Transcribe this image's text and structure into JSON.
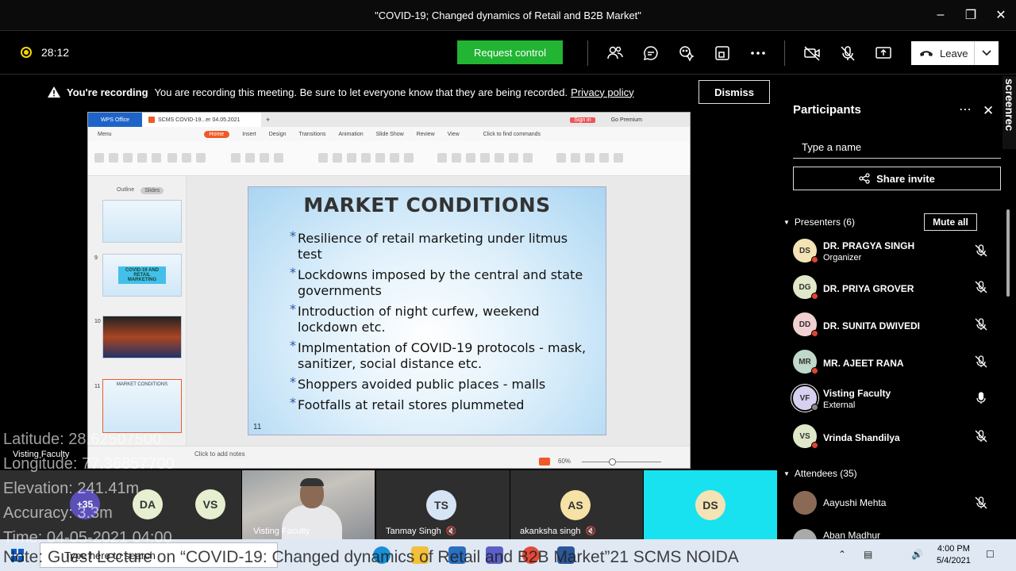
{
  "window": {
    "title": "\"COVID-19; Changed dynamics of Retail and B2B Market\""
  },
  "toolbar": {
    "timer": "28:12",
    "request_control": "Request control",
    "leave": "Leave"
  },
  "recording": {
    "bold": "You're recording",
    "message": "You are recording this meeting. Be sure to let everyone know that they are being recorded.",
    "policy": "Privacy policy",
    "dismiss": "Dismiss"
  },
  "wps": {
    "tab_app": "WPS Office",
    "tab_doc": "SCMS COVID-19...er 04.05.2021",
    "sign_in": "Sign in",
    "premium": "Go Premium",
    "menu": "Menu",
    "ribbon_tabs": [
      "Home",
      "Insert",
      "Design",
      "Transitions",
      "Animation",
      "Slide Show",
      "Review",
      "View"
    ],
    "find": "Click to find commands",
    "outline": "Outline",
    "slides": "Slides",
    "thumb_numbers": [
      "9",
      "10",
      "11"
    ],
    "thumb9_text": "COVID-19 AND RETAIL MARKETING",
    "thumb11_text": "MARKET CONDITIONS",
    "click_notes": "Click to add notes",
    "zoom": "60%"
  },
  "slide": {
    "title": "MARKET CONDITIONS",
    "bullets": [
      "Resilience of retail marketing under litmus test",
      "Lockdowns imposed by the central and state governments",
      "Introduction of night curfew, weekend lockdown etc.",
      "Implmentation of COVID-19 protocols - mask, sanitizer, social distance etc.",
      "Shoppers avoided public places - malls",
      "Footfalls at retail stores plummeted"
    ],
    "page_number": "11"
  },
  "participants": {
    "title": "Participants",
    "search_placeholder": "Type a name",
    "share_invite": "Share invite",
    "presenters_label": "Presenters (6)",
    "mute_all": "Mute all",
    "attendees_label": "Attendees (35)",
    "presenters": [
      {
        "initials": "DS",
        "name": "DR. PRAGYA SINGH",
        "role": "Organizer",
        "color": "#f3e3b5"
      },
      {
        "initials": "DG",
        "name": "DR. PRIYA GROVER",
        "role": "",
        "color": "#dfe8c8"
      },
      {
        "initials": "DD",
        "name": "DR. SUNITA DWIVEDI",
        "role": "",
        "color": "#f0d0d0"
      },
      {
        "initials": "MR",
        "name": "MR. AJEET RANA",
        "role": "",
        "color": "#bfd8c8"
      },
      {
        "initials": "VF",
        "name": "Visting Faculty",
        "role": "External",
        "color": "#d7d0ef"
      },
      {
        "initials": "VS",
        "name": "Vrinda Shandilya",
        "role": "",
        "color": "#dfe8c8"
      }
    ],
    "attendees": [
      {
        "name": "Aayushi Mehta"
      },
      {
        "name": "Aban Madhur"
      }
    ]
  },
  "gallery": {
    "overflow": "+35",
    "tiles": [
      {
        "initials": "DA",
        "color": "#e6efcf"
      },
      {
        "initials": "VS",
        "color": "#e6efcf"
      }
    ],
    "video_name": "Visting Faculty",
    "ts": {
      "initials": "TS",
      "name": "Tanmay Singh",
      "color": "#d6e4f6"
    },
    "as": {
      "initials": "AS",
      "name": "akanksha singh",
      "color": "#f6e2a6"
    },
    "ds": {
      "initials": "DS",
      "color": "#f3e3b5"
    }
  },
  "overlay": {
    "latitude": "Latitude: 28.62507500",
    "longitude": "Longitude: 77.36857700",
    "elevation": "Elevation: 241.41m",
    "accuracy": "Accuracy: 3.3m",
    "time": "Time: 04-05-2021  04:00",
    "vf_label": "Visting Faculty",
    "note": "Note: Guest Lecture on “COVID-19: Changed dynamics of Retail and B2B Market”21 SCMS NOIDA"
  },
  "taskbar": {
    "search": "Type here to search",
    "time": "4:00 PM",
    "date": "5/4/2021"
  },
  "watermark": "screenrec"
}
